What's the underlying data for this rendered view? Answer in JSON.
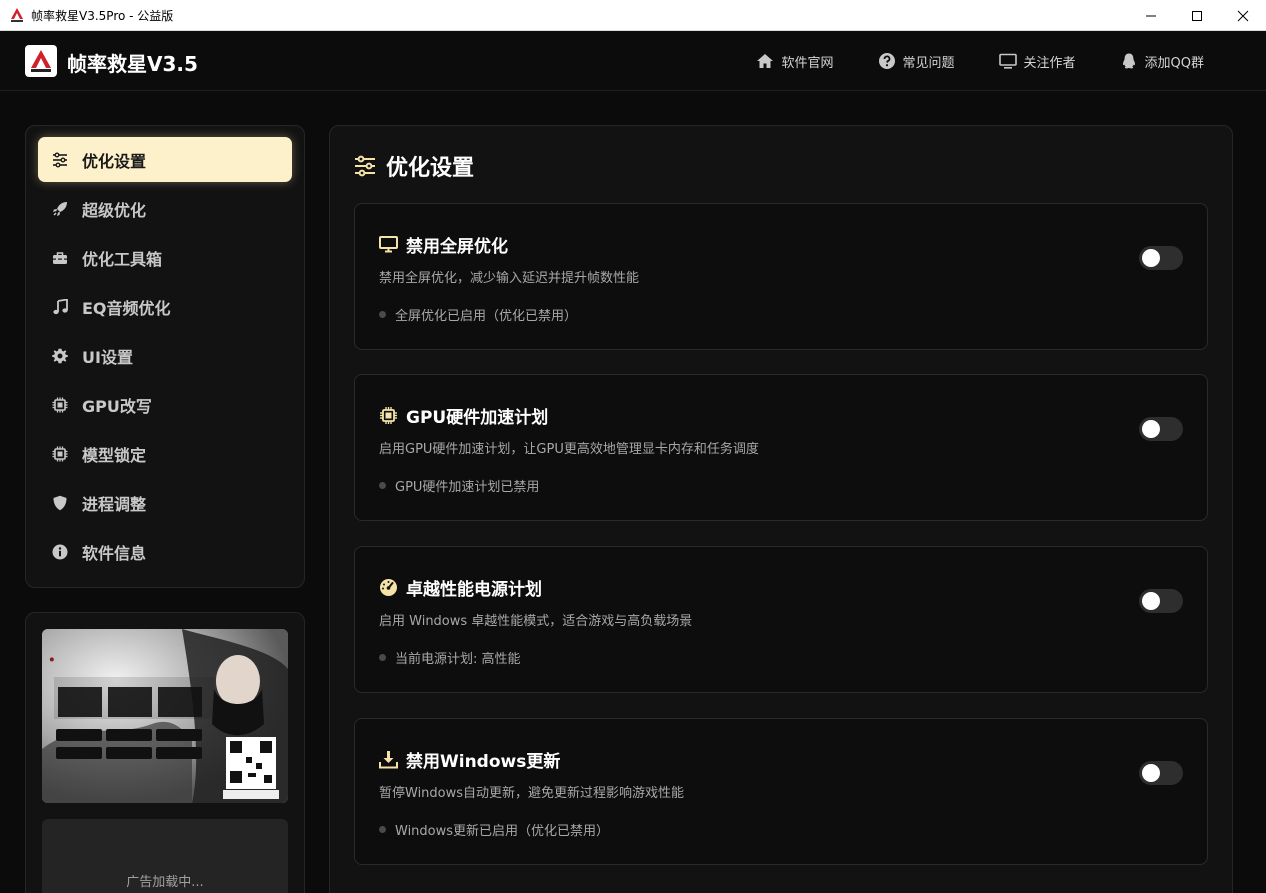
{
  "window": {
    "title": "帧率救星V3.5Pro - 公益版"
  },
  "header": {
    "app_name": "帧率救星V3.5",
    "nav": [
      {
        "label": "软件官网",
        "icon": "home-icon"
      },
      {
        "label": "常见问题",
        "icon": "question-circle-icon"
      },
      {
        "label": "关注作者",
        "icon": "monitor-icon"
      },
      {
        "label": "添加QQ群",
        "icon": "qq-penguin-icon"
      }
    ]
  },
  "sidebar": {
    "items": [
      {
        "label": "优化设置",
        "icon": "sliders-icon",
        "active": true
      },
      {
        "label": "超级优化",
        "icon": "rocket-icon"
      },
      {
        "label": "优化工具箱",
        "icon": "toolbox-icon"
      },
      {
        "label": "EQ音频优化",
        "icon": "music-note-icon"
      },
      {
        "label": "UI设置",
        "icon": "gear-icon"
      },
      {
        "label": "GPU改写",
        "icon": "chip-icon"
      },
      {
        "label": "模型锁定",
        "icon": "chip-icon"
      },
      {
        "label": "进程调整",
        "icon": "shield-icon"
      },
      {
        "label": "软件信息",
        "icon": "info-icon"
      }
    ]
  },
  "ad": {
    "loading_text": "广告加载中..."
  },
  "main": {
    "title": "优化设置",
    "title_icon": "sliders-icon",
    "cards": [
      {
        "title": "禁用全屏优化",
        "icon": "monitor-icon",
        "desc": "禁用全屏优化，减少输入延迟并提升帧数性能",
        "status": "全屏优化已启用（优化已禁用）",
        "enabled": false
      },
      {
        "title": "GPU硬件加速计划",
        "icon": "chip-icon",
        "desc": "启用GPU硬件加速计划，让GPU更高效地管理显卡内存和任务调度",
        "status": "GPU硬件加速计划已禁用",
        "enabled": false
      },
      {
        "title": "卓越性能电源计划",
        "icon": "gauge-icon",
        "desc": "启用 Windows 卓越性能模式，适合游戏与高负载场景",
        "status": "当前电源计划: 高性能",
        "enabled": false
      },
      {
        "title": "禁用Windows更新",
        "icon": "download-icon",
        "desc": "暂停Windows自动更新，避免更新过程影响游戏性能",
        "status": "Windows更新已启用（优化已禁用）",
        "enabled": false
      }
    ]
  },
  "colors": {
    "accent": "#fdf1cc",
    "icon_accent": "#f5e2a8",
    "background": "#0b0b0b"
  }
}
